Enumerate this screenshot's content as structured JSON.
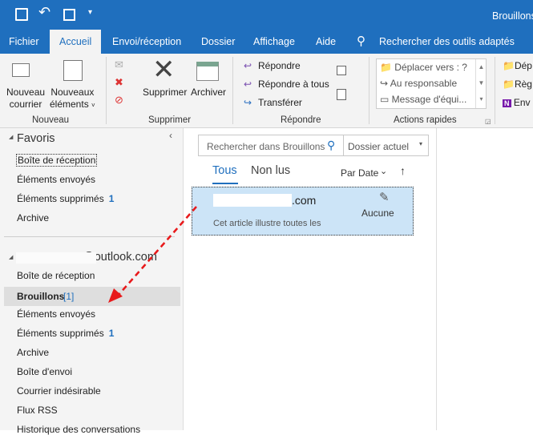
{
  "titlebar": {
    "title": "Brouillons"
  },
  "tabs": [
    "Fichier",
    "Accueil",
    "Envoi/réception",
    "Dossier",
    "Affichage",
    "Aide"
  ],
  "tell_me": "Rechercher des outils adaptés",
  "ribbon": {
    "nouveau": {
      "new_mail": [
        "Nouveau",
        "courrier"
      ],
      "new_items": [
        "Nouveaux",
        "éléments"
      ],
      "label": "Nouveau"
    },
    "supprimer": {
      "delete": "Supprimer",
      "archive": "Archiver",
      "label": "Supprimer"
    },
    "repondre": {
      "reply": "Répondre",
      "reply_all": "Répondre à tous",
      "forward": "Transférer",
      "label": "Répondre"
    },
    "quick": {
      "items": [
        "Déplacer vers : ?",
        "Au responsable",
        "Message d'équi..."
      ],
      "label": "Actions rapides"
    },
    "move": {
      "items": [
        "Dép",
        "Règ",
        "Env"
      ]
    }
  },
  "favorites": {
    "title": "Favoris",
    "items": [
      {
        "label": "Boîte de réception"
      },
      {
        "label": "Éléments envoyés"
      },
      {
        "label": "Éléments supprimés",
        "count": "1"
      },
      {
        "label": "Archive"
      }
    ]
  },
  "account": {
    "title": "@outlook.com",
    "items": [
      {
        "label": "Boîte de réception"
      },
      {
        "label": "Brouillons",
        "count": "[1]"
      },
      {
        "label": "Éléments envoyés"
      },
      {
        "label": "Éléments supprimés",
        "count": "1"
      },
      {
        "label": "Archive"
      },
      {
        "label": "Boîte d'envoi"
      },
      {
        "label": "Courrier indésirable"
      },
      {
        "label": "Flux RSS"
      },
      {
        "label": "Historique des conversations"
      }
    ]
  },
  "list": {
    "search_placeholder": "Rechercher dans Brouillons",
    "scope": "Dossier actuel",
    "filter_all": "Tous",
    "filter_unread": "Non lus",
    "sort": "Par Date",
    "message": {
      "to": ".com",
      "category": "Aucune",
      "preview": "Cet article illustre toutes les"
    }
  },
  "colors": {
    "accent": "#1f6fbe",
    "selected": "#cce4f7",
    "arrow": "#e8191b"
  }
}
